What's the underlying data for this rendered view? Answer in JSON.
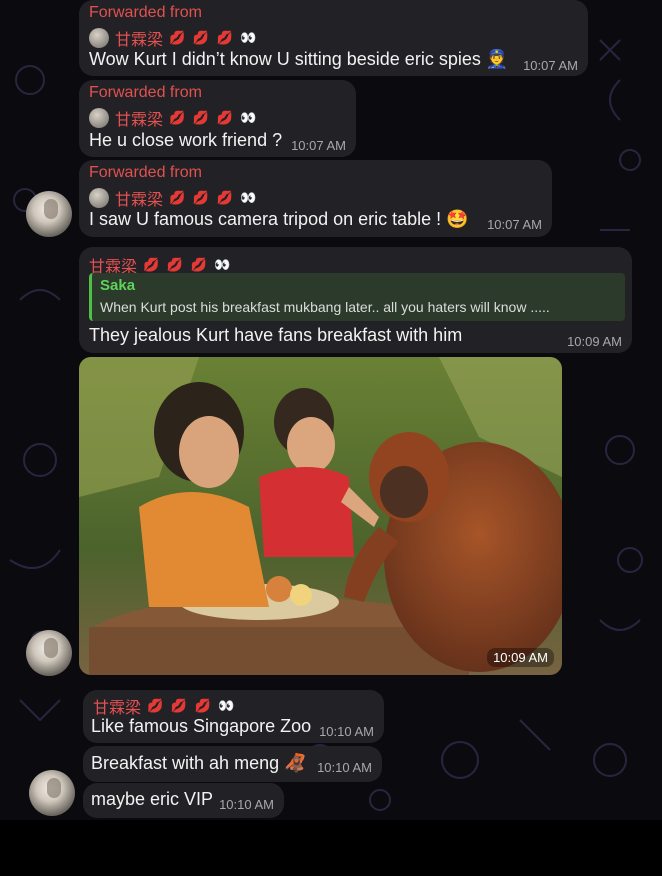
{
  "messages": [
    {
      "forwarded": "Forwarded from",
      "sender": "甘霖梁",
      "text": "Wow Kurt I didn’t know U sitting beside eric spies 👮",
      "time": "10:07 AM"
    },
    {
      "forwarded": "Forwarded from",
      "sender": "甘霖梁",
      "text": "He u close work friend ?",
      "time": "10:07 AM"
    },
    {
      "forwarded": "Forwarded from",
      "sender": "甘霖梁",
      "text": "I saw U  famous camera tripod on eric table ! 🤩",
      "time": "10:07 AM"
    },
    {
      "sender": "甘霖梁",
      "reply": {
        "name": "Saka",
        "text": "When Kurt post his breakfast mukbang later.. all you haters will know ....."
      },
      "text": "They jealous Kurt have fans breakfast with him",
      "time": "10:09 AM"
    },
    {
      "photo_time": "10:09 AM"
    },
    {
      "sender": "甘霖梁",
      "text": "Like famous Singapore Zoo",
      "time": "10:10 AM"
    },
    {
      "text": "Breakfast with ah meng 🦧",
      "time": "10:10 AM"
    },
    {
      "text": "maybe eric VIP",
      "time": "10:10 AM"
    }
  ],
  "sender_emoji": "💋 💋 💋 👀",
  "colors": {
    "bubble": "#222226",
    "sender": "#e25050",
    "reply_accent": "#4fbf47",
    "background": "#0b0b0f"
  }
}
